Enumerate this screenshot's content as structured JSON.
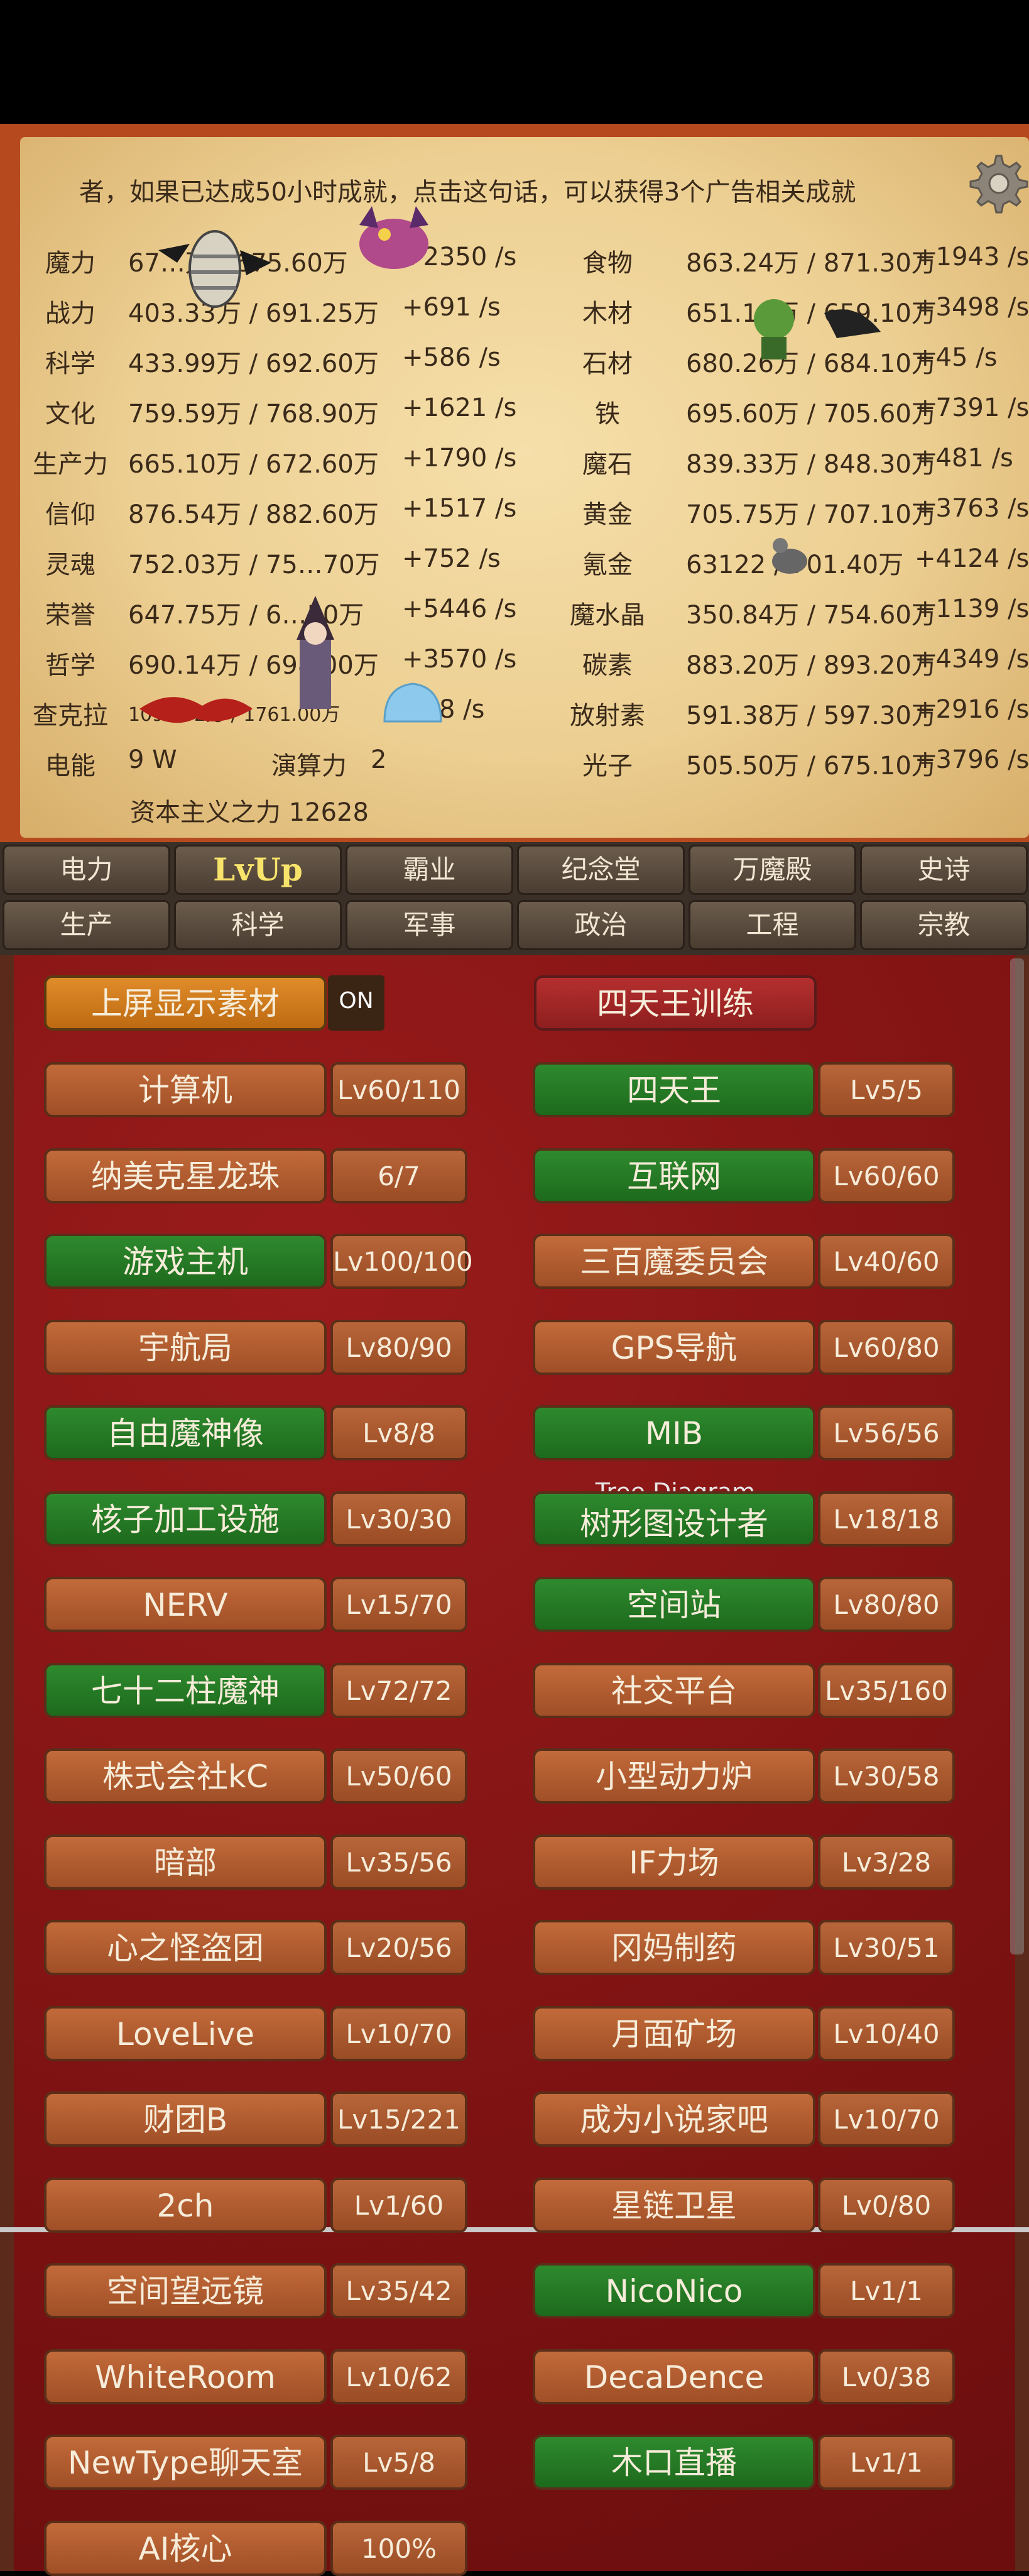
{
  "notice": "者，如果已达成50小时成就，点击这句话，可以获得3个广告相关成就",
  "resources_left": [
    {
      "name": "魔力",
      "value": "67…万 / 675.60万",
      "rate": "+2350 /s"
    },
    {
      "name": "战力",
      "value": "403.33万 / 691.25万",
      "rate": "+691 /s"
    },
    {
      "name": "科学",
      "value": "433.99万 / 692.60万",
      "rate": "+586 /s"
    },
    {
      "name": "文化",
      "value": "759.59万 / 768.90万",
      "rate": "+1621 /s"
    },
    {
      "name": "生产力",
      "value": "665.10万 / 672.60万",
      "rate": "+1790 /s"
    },
    {
      "name": "信仰",
      "value": "876.54万 / 882.60万",
      "rate": "+1517 /s"
    },
    {
      "name": "灵魂",
      "value": "752.03万 / 75…70万",
      "rate": "+752 /s"
    },
    {
      "name": "荣誉",
      "value": "647.75万 / 6…50万",
      "rate": "+5446 /s"
    },
    {
      "name": "哲学",
      "value": "690.14万 / 698.00万",
      "rate": "+3570 /s"
    },
    {
      "name": "查克拉",
      "value": "1096.72万 / 1761.00万",
      "rate": "+48 /s"
    },
    {
      "name": "电能",
      "value": "9 W",
      "rate": ""
    }
  ],
  "compute": {
    "label": "演算力",
    "value": "2"
  },
  "resources_right": [
    {
      "name": "食物",
      "value": "863.24万 / 871.30万",
      "rate": "+1943 /s"
    },
    {
      "name": "木材",
      "value": "651.19万 / 659.10万",
      "rate": "+3498 /s"
    },
    {
      "name": "石材",
      "value": "680.26万 / 684.10万",
      "rate": "+45 /s"
    },
    {
      "name": "铁",
      "value": "695.60万 / 705.60万",
      "rate": "+7391 /s"
    },
    {
      "name": "魔石",
      "value": "839.33万 / 848.30万",
      "rate": "+481 /s"
    },
    {
      "name": "黄金",
      "value": "705.75万 / 707.10万",
      "rate": "+3763 /s"
    },
    {
      "name": "氪金",
      "value": "63122 / 701.40万",
      "rate": "+4124 /s"
    },
    {
      "name": "魔水晶",
      "value": "350.84万 / 754.60万",
      "rate": "+1139 /s"
    },
    {
      "name": "碳素",
      "value": "883.20万 / 893.20万",
      "rate": "+4349 /s"
    },
    {
      "name": "放射素",
      "value": "591.38万 / 597.30万",
      "rate": "+2916 /s"
    },
    {
      "name": "光子",
      "value": "505.50万 / 675.10万",
      "rate": "+3796 /s"
    }
  ],
  "capitalism": "资本主义之力 12628",
  "tabs_row1": [
    "电力",
    "LvUp",
    "霸业",
    "纪念堂",
    "万魔殿",
    "史诗"
  ],
  "tabs_row2": [
    "生产",
    "科学",
    "军事",
    "政治",
    "工程",
    "宗教"
  ],
  "toggle": {
    "label": "上屏显示素材",
    "state": "ON"
  },
  "special": "四天王训练",
  "tree_subtitle": "Tree Diagram",
  "buildings": [
    {
      "l": "计算机",
      "lv": "Lv60/110",
      "lc": "orange",
      "r": "四天王",
      "rlv": "Lv5/5",
      "rc": "green"
    },
    {
      "l": "纳美克星龙珠",
      "lv": "6/7",
      "lc": "orange",
      "r": "互联网",
      "rlv": "Lv60/60",
      "rc": "green"
    },
    {
      "l": "游戏主机",
      "lv": "Lv100/100",
      "lc": "green",
      "r": "三百魔委员会",
      "rlv": "Lv40/60",
      "rc": "orange"
    },
    {
      "l": "宇航局",
      "lv": "Lv80/90",
      "lc": "orange",
      "r": "GPS导航",
      "rlv": "Lv60/80",
      "rc": "orange"
    },
    {
      "l": "自由魔神像",
      "lv": "Lv8/8",
      "lc": "green",
      "r": "MIB",
      "rlv": "Lv56/56",
      "rc": "green"
    },
    {
      "l": "核子加工设施",
      "lv": "Lv30/30",
      "lc": "green",
      "r": "树形图设计者",
      "rlv": "Lv18/18",
      "rc": "green"
    },
    {
      "l": "NERV",
      "lv": "Lv15/70",
      "lc": "orange",
      "r": "空间站",
      "rlv": "Lv80/80",
      "rc": "green"
    },
    {
      "l": "七十二柱魔神",
      "lv": "Lv72/72",
      "lc": "green",
      "r": "社交平台",
      "rlv": "Lv35/160",
      "rc": "orange"
    },
    {
      "l": "株式会社kC",
      "lv": "Lv50/60",
      "lc": "orange",
      "r": "小型动力炉",
      "rlv": "Lv30/58",
      "rc": "orange"
    },
    {
      "l": "暗部",
      "lv": "Lv35/56",
      "lc": "orange",
      "r": "IF力场",
      "rlv": "Lv3/28",
      "rc": "orange"
    },
    {
      "l": "心之怪盗团",
      "lv": "Lv20/56",
      "lc": "orange",
      "r": "冈妈制药",
      "rlv": "Lv30/51",
      "rc": "orange"
    },
    {
      "l": "LoveLive",
      "lv": "Lv10/70",
      "lc": "orange",
      "r": "月面矿场",
      "rlv": "Lv10/40",
      "rc": "orange"
    },
    {
      "l": "财团B",
      "lv": "Lv15/221",
      "lc": "orange",
      "r": "成为小说家吧",
      "rlv": "Lv10/70",
      "rc": "orange"
    },
    {
      "l": "2ch",
      "lv": "Lv1/60",
      "lc": "orange",
      "r": "星链卫星",
      "rlv": "Lv0/80",
      "rc": "orange"
    },
    {
      "l": "空间望远镜",
      "lv": "Lv35/42",
      "lc": "orange",
      "r": "NicoNico",
      "rlv": "Lv1/1",
      "rc": "green"
    },
    {
      "l": "WhiteRoom",
      "lv": "Lv10/62",
      "lc": "orange",
      "r": "DecaDence",
      "rlv": "Lv0/38",
      "rc": "orange"
    },
    {
      "l": "NewType聊天室",
      "lv": "Lv5/8",
      "lc": "orange",
      "r": "木口直播",
      "rlv": "Lv1/1",
      "rc": "green"
    },
    {
      "l": "AI核心",
      "lv": "100%",
      "lc": "orange",
      "r": "",
      "rlv": "",
      "rc": ""
    }
  ]
}
